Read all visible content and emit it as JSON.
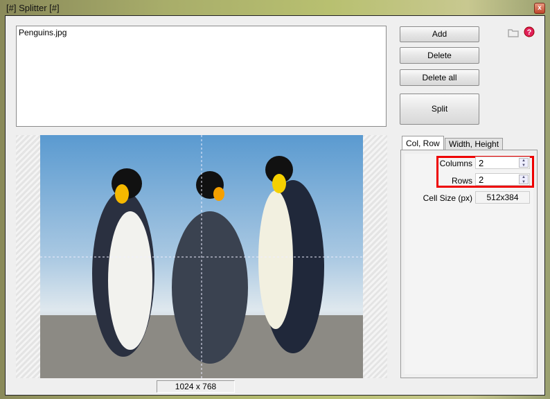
{
  "window": {
    "title": "[#] Splitter [#]",
    "close_icon": "x"
  },
  "files": [
    "Penguins.jpg"
  ],
  "buttons": {
    "add": "Add",
    "delete": "Delete",
    "delete_all": "Delete all",
    "split": "Split"
  },
  "icons": [
    "folder-icon",
    "help-icon"
  ],
  "preview": {
    "dimensions": "1024 x 768",
    "grid_columns": 2,
    "grid_rows": 2
  },
  "tabs": [
    {
      "label": "Col, Row",
      "active": true
    },
    {
      "label": "Width, Height",
      "active": false
    }
  ],
  "colrow": {
    "columns_label": "Columns",
    "columns_value": "2",
    "rows_label": "Rows",
    "rows_value": "2",
    "cell_size_label": "Cell Size (px)",
    "cell_size_value": "512x384"
  },
  "colors": {
    "highlight": "#e00000"
  }
}
